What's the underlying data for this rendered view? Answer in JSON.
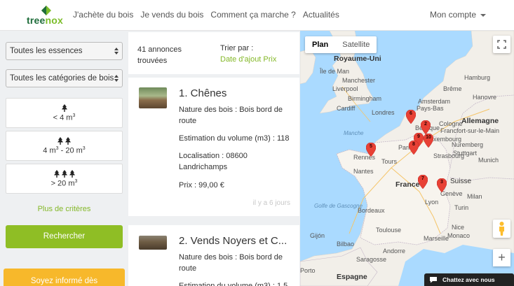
{
  "header": {
    "logo_text_1": "tree",
    "logo_text_2": "nox",
    "nav": [
      "J'achète du bois",
      "Je vends du bois",
      "Comment ça marche ?",
      "Actualités"
    ],
    "account": "Mon compte"
  },
  "filters": {
    "essence_select": "Toutes les essences",
    "category_select": "Toutes les catégories de bois",
    "volumes": [
      {
        "label": "< 4 m",
        "sup": "3",
        "trees": 1
      },
      {
        "label": "4 m",
        "sup": "3",
        "label_b": " - 20 m",
        "sup_b": "3",
        "trees": 2
      },
      {
        "label": "> 20 m",
        "sup": "3",
        "trees": 3
      }
    ],
    "more_criteria": "Plus de critères",
    "search_button": "Rechercher",
    "inform_button": "Soyez informé dès"
  },
  "listings": {
    "count": "41 annonces trouvées",
    "sort_label": "Trier par :",
    "sort_value": "Date d'ajout Prix",
    "items": [
      {
        "title": "1. Chênes",
        "nature": "Nature des bois : Bois bord de route",
        "volume": "Estimation du volume (m3) : 118",
        "location": "Localisation : 08600 Landrichamps",
        "price": "Prix : 99,00 €",
        "ago": "il y a 6 jours"
      },
      {
        "title": "2. Vends Noyers et C...",
        "nature": "Nature des bois : Bois bord de route",
        "volume": "Estimation du volume (m3) : 1,5"
      }
    ]
  },
  "map": {
    "type_plan": "Plan",
    "type_satellite": "Satellite",
    "chat": "Chattez avec nous",
    "labels": {
      "royaume_uni": "Royaume-Uni",
      "allemagne": "Allemagne",
      "france": "France",
      "espagne": "Espagne",
      "pays_bas": "Pays-Bas",
      "belgique": "Belgique",
      "luxembourg": "Luxembourg",
      "suisse": "Suisse",
      "ile_de_man": "Île de Man",
      "manchester": "Manchester",
      "liverpool": "Liverpool",
      "birmingham": "Birmingham",
      "cardiff": "Cardiff",
      "londres": "Londres",
      "hamburg": "Hamburg",
      "brême": "Brême",
      "amsterdam": "Amsterdam",
      "hanovre": "Hanovre",
      "cologne": "Cologne",
      "francfort": "Francfort-sur-le-Main",
      "paris": "Paris",
      "nantes": "Nantes",
      "lyon": "Lyon",
      "bordeaux": "Bordeaux",
      "toulouse": "Toulouse",
      "stuttgart": "Stuttgart",
      "munich": "Munich",
      "milan": "Milan",
      "turin": "Turin",
      "monaco": "Monaco",
      "bilbao": "Bilbao",
      "andorre": "Andorre",
      "golfe": "Golfe de Gascogne",
      "manche": "Manche",
      "nuremberg": "Nuremberg",
      "rennes": "Rennes",
      "tours": "Tours",
      "nice": "Nice",
      "geneve": "Genève",
      "marseille": "Marseille",
      "porto": "Porto",
      "gijon": "Gijón",
      "saragosse": "Saragosse",
      "strasbourg": "Strasbourg"
    },
    "markers": [
      "6",
      "2",
      "9",
      "10",
      "8",
      "5",
      "7",
      "3"
    ]
  },
  "colors": {
    "green": "#8fbe25",
    "orange": "#f7b82b",
    "marker": "#e84135",
    "sea": "#aadaff",
    "land": "#f2efe9"
  }
}
